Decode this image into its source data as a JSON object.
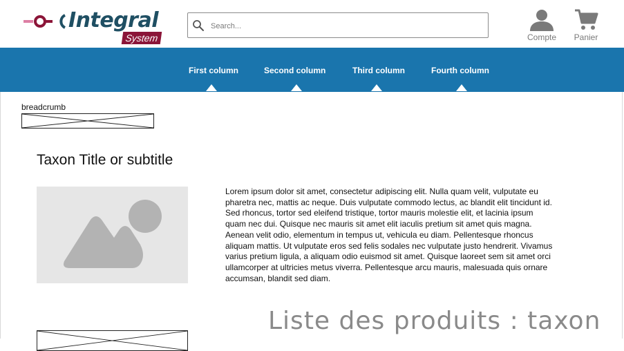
{
  "brand": {
    "name": "Integral",
    "subtitle": "System",
    "accent": "#8b1538",
    "primary": "#1f4f63"
  },
  "search": {
    "placeholder": "Search..."
  },
  "header_actions": {
    "account_label": "Compte",
    "cart_label": "Panier"
  },
  "nav": {
    "background": "#1a75ad",
    "items": [
      {
        "label": "First column"
      },
      {
        "label": "Second column"
      },
      {
        "label": "Third column"
      },
      {
        "label": "Fourth column"
      }
    ]
  },
  "breadcrumb": {
    "label": "breadcrumb"
  },
  "content": {
    "taxon_title": "Taxon Title or subtitle",
    "description": "Lorem ipsum dolor sit amet, consectetur adipiscing elit. Nulla quam velit, vulputate eu pharetra nec, mattis ac neque. Duis vulputate commodo lectus, ac blandit elit tincidunt id. Sed rhoncus, tortor sed eleifend tristique, tortor mauris molestie elit, et lacinia ipsum quam nec dui. Quisque nec mauris sit amet elit iaculis pretium sit amet quis magna. Aenean velit odio, elementum in tempus ut, vehicula eu diam. Pellentesque rhoncus aliquam mattis. Ut vulputate eros sed felis sodales nec vulputate justo hendrerit. Vivamus varius pretium ligula, a aliquam odio euismod sit amet. Quisque laoreet sem sit amet orci ullamcorper at ultricies metus viverra. Pellentesque arcu mauris, malesuada quis ornare accumsan, blandit sed diam.",
    "list_title": "Liste des produits : taxon"
  },
  "icons": {
    "search": "search-icon",
    "account": "user-icon",
    "cart": "cart-icon",
    "image_placeholder": "image-placeholder-icon"
  }
}
